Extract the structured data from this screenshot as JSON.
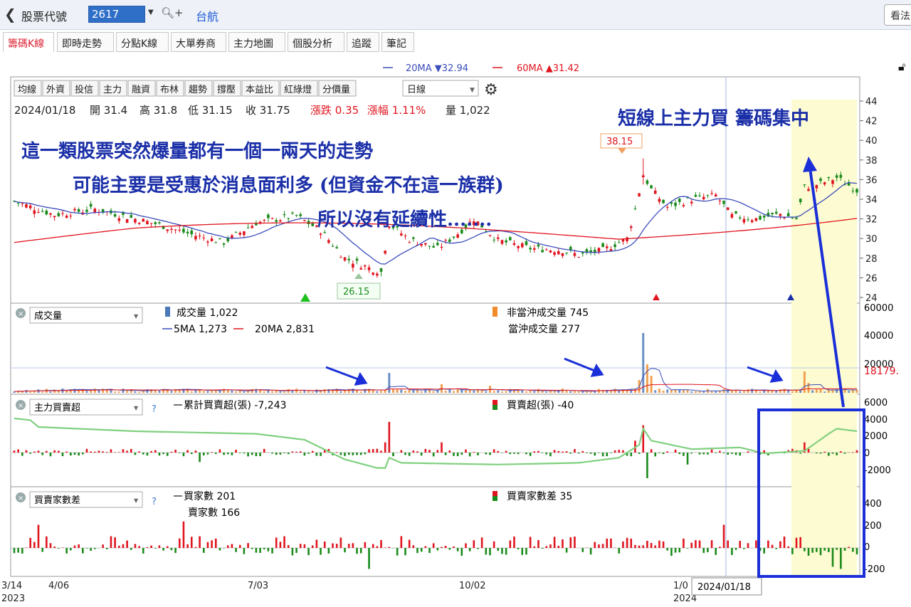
{
  "topbar": {
    "back_icon": "chevron-left-icon",
    "code_label": "股票代號",
    "code_value": "2617",
    "stock_name": "台航",
    "view_button": "看法"
  },
  "tabs": [
    "籌碼K線",
    "即時走勢",
    "分點K線",
    "大單券商",
    "主力地圖",
    "個股分析",
    "追蹤",
    "筆記"
  ],
  "ma_legend": {
    "ma20": "20MA ▼32.94",
    "ma60": "60MA ▲31.42"
  },
  "toolbar": {
    "buttons": [
      "均線",
      "外資",
      "投信",
      "主力",
      "融資",
      "布林",
      "趨勢",
      "撐壓",
      "本益比",
      "紅綠燈",
      "分價量"
    ],
    "period": "日線",
    "settings_icon": "gear-icon",
    "lock_icon": "unlock-icon"
  },
  "quote": {
    "date": "2024/01/18",
    "open": "開 31.4",
    "high": "高 31.8",
    "low": "低 31.15",
    "close": "收 31.75",
    "change": "漲跌 0.35",
    "change_pct": "漲幅 1.11%",
    "volume": "量 1,022"
  },
  "price_axis": [
    "44",
    "42",
    "40",
    "38",
    "36",
    "34",
    "32",
    "30",
    "28",
    "26",
    "24"
  ],
  "price_labels": {
    "high": "38.15",
    "low": "26.15"
  },
  "volume_panel": {
    "selector": "成交量",
    "vol": "成交量 1,022",
    "ma5": "5MA 1,273",
    "ma20": "20MA 2,831",
    "non_daytrade": "非當沖成交量 745",
    "daytrade": "當沖成交量 277",
    "axis": [
      "60000",
      "40000",
      "20000"
    ],
    "marker": "18179."
  },
  "main_force_panel": {
    "selector": "主力買賣超",
    "help": "?",
    "cumulative": "累計買賣超(張) -7,243",
    "net": "買賣超(張) -40",
    "axis": [
      "6000",
      "4000",
      "2000",
      "0",
      "-2000"
    ]
  },
  "broker_panel": {
    "selector": "買賣家數差",
    "help": "?",
    "buyers": "買家數 201",
    "sellers": "賣家數 166",
    "diff": "買賣家數差 35",
    "axis": [
      "400",
      "200",
      "0",
      "-200"
    ]
  },
  "x_axis": [
    "3/14\n2023",
    "4/06",
    "7/03",
    "10/02",
    "1/0\n2024"
  ],
  "crosshair_date": "2024/01/18",
  "annotations": {
    "line1": "這一類股票突然爆量都有一個一兩天的走勢",
    "line2": "可能主要是受惠於消息面利多 (但資金不在這一族群)",
    "line3": "所以沒有延續性.......",
    "right": "短線上主力買 籌碼集中"
  },
  "colors": {
    "up": "#e0141e",
    "down": "#1a8a1a",
    "accent": "#1d5bd6",
    "annotation": "#1b2fa8",
    "highlight": "#fdfbd2"
  }
}
